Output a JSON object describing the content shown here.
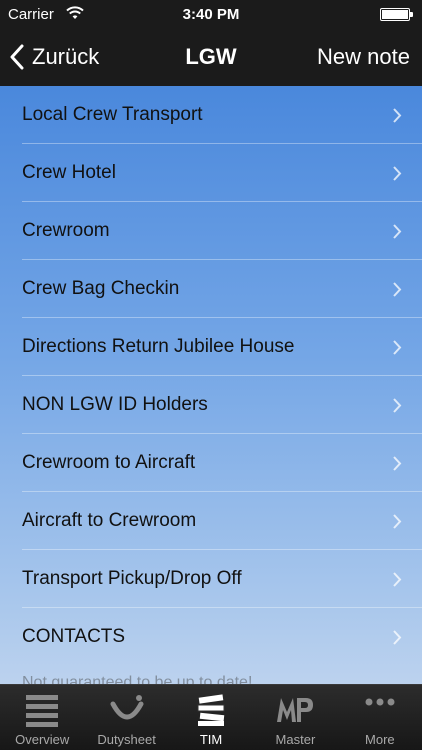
{
  "status_bar": {
    "carrier": "Carrier",
    "time": "3:40 PM",
    "battery_level": 1.0
  },
  "nav": {
    "back_label": "Zurück",
    "title": "LGW",
    "right_button": "New note"
  },
  "list": {
    "items": [
      {
        "label": "Local Crew Transport"
      },
      {
        "label": "Crew Hotel"
      },
      {
        "label": "Crewroom"
      },
      {
        "label": "Crew Bag Checkin"
      },
      {
        "label": "Directions Return Jubilee House"
      },
      {
        "label": "NON LGW ID Holders"
      },
      {
        "label": "Crewroom to Aircraft"
      },
      {
        "label": "Aircraft to Crewroom"
      },
      {
        "label": "Transport Pickup/Drop Off"
      },
      {
        "label": "CONTACTS"
      }
    ],
    "footer_note": "Not guaranteed to be up to date!"
  },
  "tab_bar": {
    "tabs": [
      {
        "label": "Overview",
        "icon": "list-icon"
      },
      {
        "label": "Dutysheet",
        "icon": "tui-smile-icon"
      },
      {
        "label": "TIM",
        "icon": "books-icon",
        "active": true
      },
      {
        "label": "Master",
        "icon": "mp-logo-icon"
      },
      {
        "label": "More",
        "icon": "more-dots-icon"
      }
    ]
  },
  "colors": {
    "bar_background": "#1b1b1b",
    "list_gradient_top": "#4a88dc",
    "list_gradient_bottom": "#bcd2ee"
  }
}
